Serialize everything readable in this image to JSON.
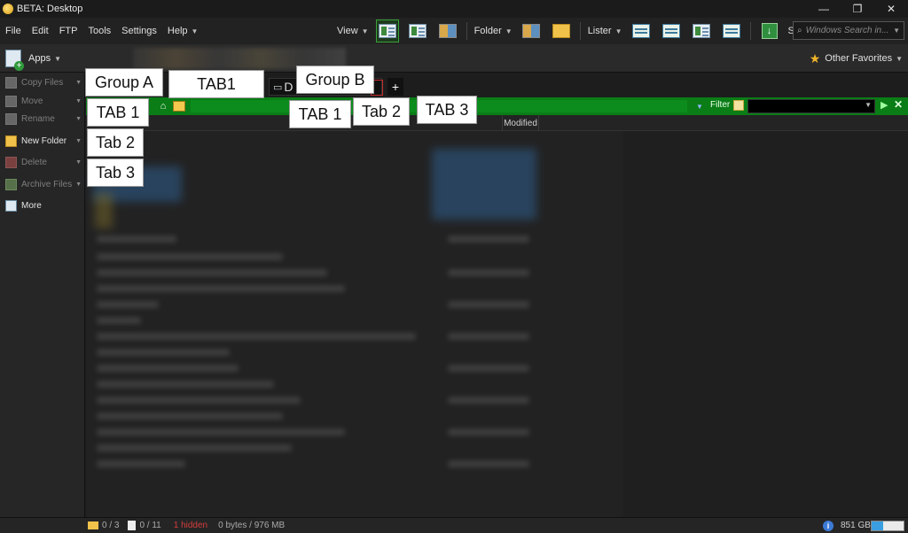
{
  "window": {
    "title": "BETA: Desktop",
    "minimize": "—",
    "restore": "❐",
    "close": "✕"
  },
  "menu": {
    "items": [
      "File",
      "Edit",
      "FTP",
      "Tools",
      "Settings",
      "Help"
    ]
  },
  "toolbar": {
    "view_label": "View",
    "folder_label": "Folder",
    "lister_label": "Lister",
    "sort_label": "Sort By",
    "sort_icon": "↓",
    "search_placeholder": "Windows Search in..."
  },
  "apps_bar": {
    "apps_label": "Apps",
    "favorites_label": "Other Favorites"
  },
  "sidebar": {
    "items": [
      {
        "label": "Copy Files",
        "enabled": false,
        "dropdown": true
      },
      {
        "label": "Move",
        "enabled": false,
        "dropdown": true
      },
      {
        "label": "Rename",
        "enabled": false,
        "dropdown": true
      },
      {
        "label": "New Folder",
        "enabled": true,
        "dropdown": true
      },
      {
        "label": "Delete",
        "enabled": false,
        "dropdown": true
      },
      {
        "label": "Archive Files",
        "enabled": false,
        "dropdown": true
      },
      {
        "label": "More",
        "enabled": true,
        "dropdown": false
      }
    ]
  },
  "tabs": {
    "tab_text": "D",
    "add_label": "+"
  },
  "pathbar": {
    "home_icon": "⌂",
    "filter_label": "Filter",
    "play_icon": "▶",
    "close_icon": "✕"
  },
  "columns": {
    "modified": "Modified"
  },
  "annotations": {
    "group_a": "Group A",
    "group_b": "Group B",
    "tab1_top": "TAB1",
    "a_tab1": "TAB 1",
    "a_tab2": "Tab 2",
    "a_tab3": "Tab 3",
    "b_tab1": "TAB 1",
    "b_tab2": "Tab 2",
    "b_tab3": "TAB 3"
  },
  "status": {
    "folders": "0 / 3",
    "files": "0 / 11",
    "hidden": "1 hidden",
    "bytes": "0 bytes / 976 MB",
    "free_space": "851 GB",
    "free_fraction": 0.35,
    "info_icon": "i"
  },
  "colors": {
    "path_green": "#0a7d16",
    "accent_blue": "#3a9ee0",
    "hidden_red": "#d43c3c"
  }
}
